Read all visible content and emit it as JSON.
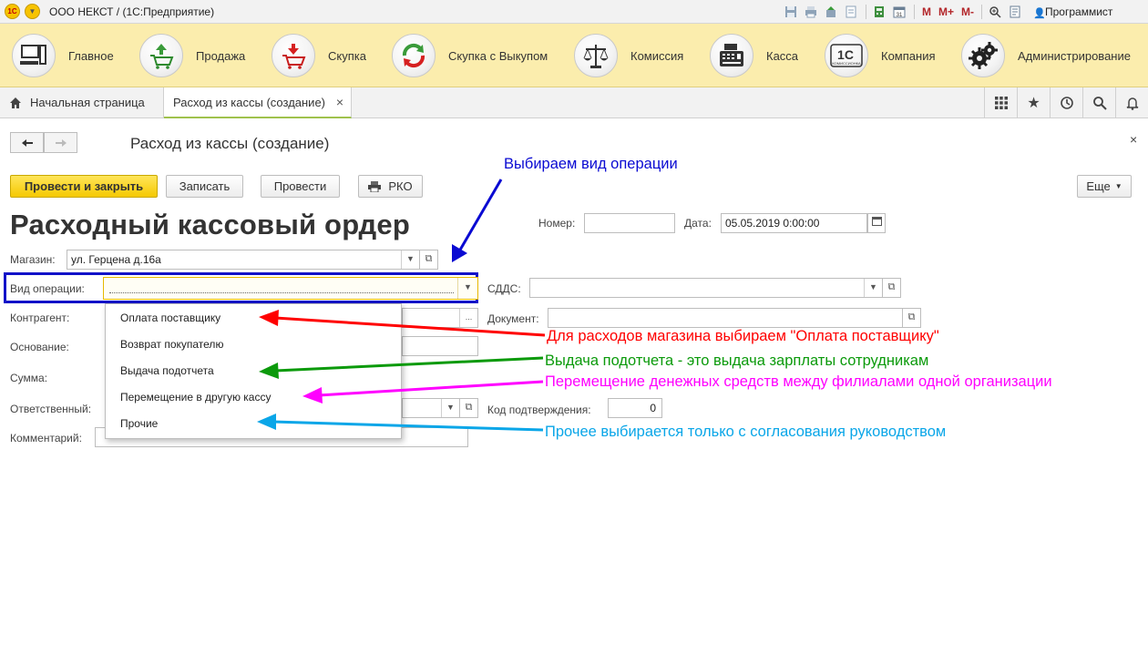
{
  "titlebar": {
    "title": "ООО НЕКСТ /  (1С:Предприятие)",
    "m_labels": [
      "M",
      "M+",
      "M-"
    ],
    "user": "Программист"
  },
  "sections": [
    {
      "label": "Главное",
      "icon": "computer-icon"
    },
    {
      "label": "Продажа",
      "icon": "cart-up-icon"
    },
    {
      "label": "Скупка",
      "icon": "cart-down-icon"
    },
    {
      "label": "Скупка с Выкупом",
      "icon": "cycle-arrows-icon"
    },
    {
      "label": "Комиссия",
      "icon": "scales-icon"
    },
    {
      "label": "Касса",
      "icon": "cash-register-icon"
    },
    {
      "label": "Компания",
      "icon": "1c-company-icon"
    },
    {
      "label": "Администрирование",
      "icon": "gears-icon"
    }
  ],
  "tabs": {
    "home": "Начальная страница",
    "active": "Расход из кассы (создание)",
    "close": "×"
  },
  "form": {
    "title": "Расход из кассы (создание)",
    "close": "×",
    "buttons": {
      "post_close": "Провести и закрыть",
      "save": "Записать",
      "post": "Провести",
      "rko": "РКО",
      "more": "Еще"
    },
    "heading": "Расходный кассовый ордер",
    "number_label": "Номер:",
    "number_value": "",
    "date_label": "Дата:",
    "date_value": "05.05.2019  0:00:00",
    "store_label": "Магазин:",
    "store_value": "ул. Герцена д.16а",
    "op_label": "Вид операции:",
    "op_value": "",
    "cdds_label": "СДДС:",
    "cdds_value": "",
    "contractor_label": "Контрагент:",
    "document_label": "Документ:",
    "basis_label": "Основание:",
    "sum_label": "Сумма:",
    "responsible_label": "Ответственный:",
    "confirm_label": "Код подтверждения:",
    "confirm_value": "0",
    "comment_label": "Комментарий:"
  },
  "dropdown": {
    "items": [
      "Оплата поставщику",
      "Возврат покупателю",
      "Выдача подотчета",
      "Перемещение в другую кассу",
      "Прочие"
    ]
  },
  "annotations": {
    "choose_op": {
      "text": "Выбираем вид операции",
      "color": "#0a0ad2"
    },
    "supplier": {
      "text": "Для расходов магазина выбираем \"Оплата поставщику\"",
      "color": "#ff0000"
    },
    "advance": {
      "text": "Выдача подотчета - это выдача  зарплаты сотрудникам",
      "color": "#0b9a0b"
    },
    "transfer": {
      "text": "Перемещение денежных средств между филиалами одной организации",
      "color": "#ff00ff"
    },
    "other": {
      "text": "Прочее выбирается только с согласования руководством",
      "color": "#0aa6e8"
    }
  },
  "colors": {
    "section_bg": "#fbedad",
    "primary_button": "#f5c900",
    "highlight_border": "#1212c8"
  }
}
